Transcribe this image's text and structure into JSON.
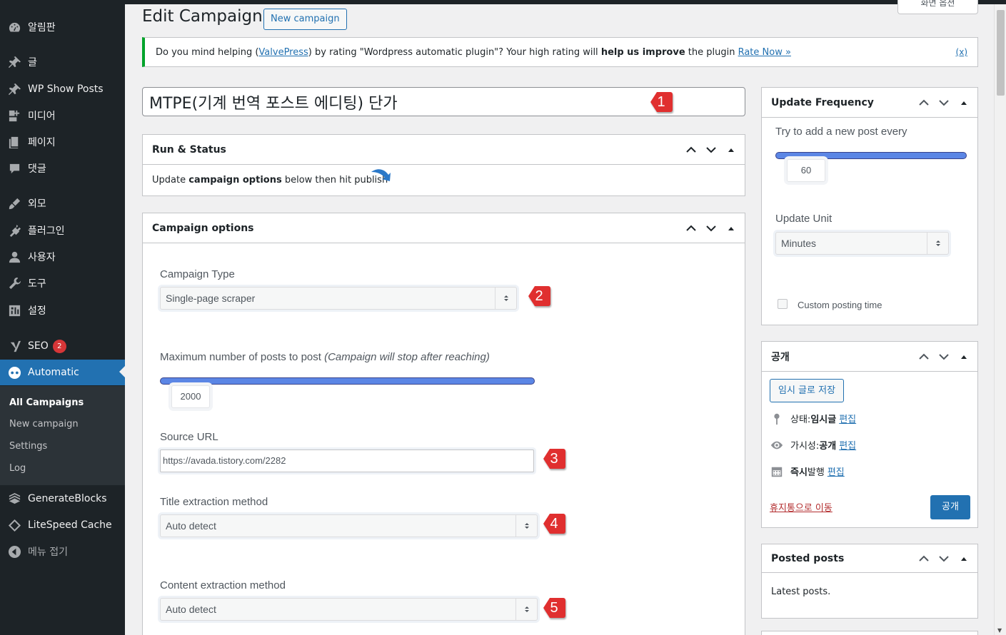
{
  "sidebar": {
    "items": [
      {
        "label": "알림판",
        "icon": "dashboard-icon"
      },
      {
        "label": "글",
        "icon": "pin-icon"
      },
      {
        "label": "WP Show Posts",
        "icon": "pin-icon"
      },
      {
        "label": "미디어",
        "icon": "media-icon"
      },
      {
        "label": "페이지",
        "icon": "page-icon"
      },
      {
        "label": "댓글",
        "icon": "comment-icon"
      },
      {
        "label": "외모",
        "icon": "brush-icon"
      },
      {
        "label": "플러그인",
        "icon": "plugin-icon"
      },
      {
        "label": "사용자",
        "icon": "user-icon"
      },
      {
        "label": "도구",
        "icon": "wrench-icon"
      },
      {
        "label": "설정",
        "icon": "settings-icon"
      },
      {
        "label": "SEO",
        "icon": "yoast-icon",
        "badge": "2"
      },
      {
        "label": "Automatic",
        "icon": "automatic-icon"
      },
      {
        "label": "GenerateBlocks",
        "icon": "generateblocks-icon"
      },
      {
        "label": "LiteSpeed Cache",
        "icon": "litespeed-icon"
      },
      {
        "label": "메뉴 접기",
        "icon": "collapse-icon"
      }
    ],
    "submenu": [
      "All Campaigns",
      "New campaign",
      "Settings",
      "Log"
    ]
  },
  "header": {
    "screen_options": "화면 옵션",
    "title": "Edit Campaign",
    "new_campaign": "New campaign"
  },
  "notice": {
    "text1": "Do you mind helping (",
    "link": "ValvePress",
    "text2": ") by rating \"Wordpress automatic plugin\"? Your high rating will ",
    "bold": "help us improve",
    "text3": " the plugin ",
    "rate_now": "Rate Now »",
    "dismiss": "(x)"
  },
  "post_title": "MTPE(기계 번역 포스트 에디팅) 단가",
  "run_status": {
    "title": "Run & Status",
    "text_before": "Update ",
    "text_bold": "campaign options",
    "text_after": " below then hit publish"
  },
  "campaign_options": {
    "title": "Campaign options",
    "campaign_type_label": "Campaign Type",
    "campaign_type_value": "Single-page scraper",
    "max_posts_label": "Maximum number of posts to post ",
    "max_posts_note": "(Campaign will stop after reaching)",
    "max_posts_value": "2000",
    "source_url_label": "Source URL",
    "source_url_value": "https://avada.tistory.com/2282",
    "title_method_label": "Title extraction method",
    "title_method_value": "Auto detect",
    "content_method_label": "Content extraction method",
    "content_method_value": "Auto detect"
  },
  "markers": [
    "1",
    "2",
    "3",
    "4",
    "5"
  ],
  "update_frequency": {
    "title": "Update Frequency",
    "try_label": "Try to add a new post every",
    "value": "60",
    "unit_label": "Update Unit",
    "unit_value": "Minutes",
    "custom_time": "Custom posting time"
  },
  "publish": {
    "title": "공개",
    "save_draft": "임시 글로 저장",
    "status_label": "상태: ",
    "status_value": "임시글",
    "visibility_label": "가시성: ",
    "visibility_value": "공개",
    "schedule_bold": "즉시",
    "schedule_text": " 발행",
    "edit": "편집",
    "trash": "휴지통으로 이동",
    "publish_button": "공개"
  },
  "posted_posts": {
    "title": "Posted posts",
    "text": "Latest posts."
  },
  "colors": {
    "accent": "#2271b1",
    "sidebar_bg": "#1d2327",
    "marker_red": "#e02f2f",
    "slider_blue": "#5b86e5"
  }
}
